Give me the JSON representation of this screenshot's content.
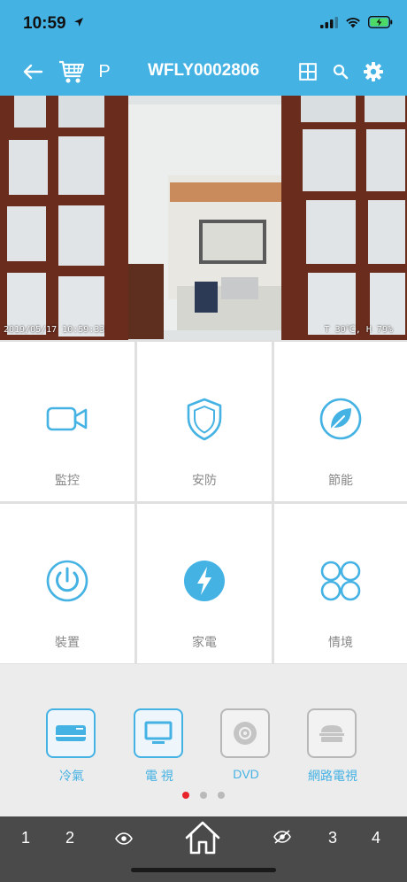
{
  "status_bar": {
    "time": "10:59",
    "location_icon": "location-arrow-icon",
    "signal_icon": "signal-icon",
    "wifi_icon": "wifi-icon",
    "battery_icon": "battery-charging-icon"
  },
  "nav": {
    "title": "WFLY0002806",
    "p_label": "P",
    "back_icon": "back-arrow-icon",
    "cart_icon": "cart-icon",
    "grid_icon": "grid-layout-icon",
    "search_icon": "search-icon",
    "settings_icon": "gear-icon"
  },
  "camera": {
    "timestamp": "2019/05/17 10:59:33",
    "sensor": "T 30℃, H 79%"
  },
  "tiles": [
    {
      "label": "監控",
      "icon": "video-camera-icon"
    },
    {
      "label": "安防",
      "icon": "shield-icon"
    },
    {
      "label": "節能",
      "icon": "leaf-icon"
    },
    {
      "label": "裝置",
      "icon": "power-icon"
    },
    {
      "label": "家電",
      "icon": "lightning-icon"
    },
    {
      "label": "情境",
      "icon": "scenes-icon"
    }
  ],
  "appliances": [
    {
      "label": "冷氣",
      "icon": "air-conditioner-icon"
    },
    {
      "label": "電 視",
      "icon": "tv-icon"
    },
    {
      "label": "DVD",
      "icon": "dvd-icon"
    },
    {
      "label": "網路電視",
      "icon": "network-tv-icon"
    }
  ],
  "pager": {
    "count": 3,
    "active": 1
  },
  "bottom_bar": {
    "item1": "1",
    "item2": "2",
    "item3": "3",
    "item4": "4",
    "eye_icon": "eye-icon",
    "eye_off_icon": "eye-off-icon",
    "home_icon": "home-icon"
  },
  "colors": {
    "accent": "#45b2e4",
    "active_dot": "#e8232a",
    "bottom_bar": "#4a4a4a"
  }
}
